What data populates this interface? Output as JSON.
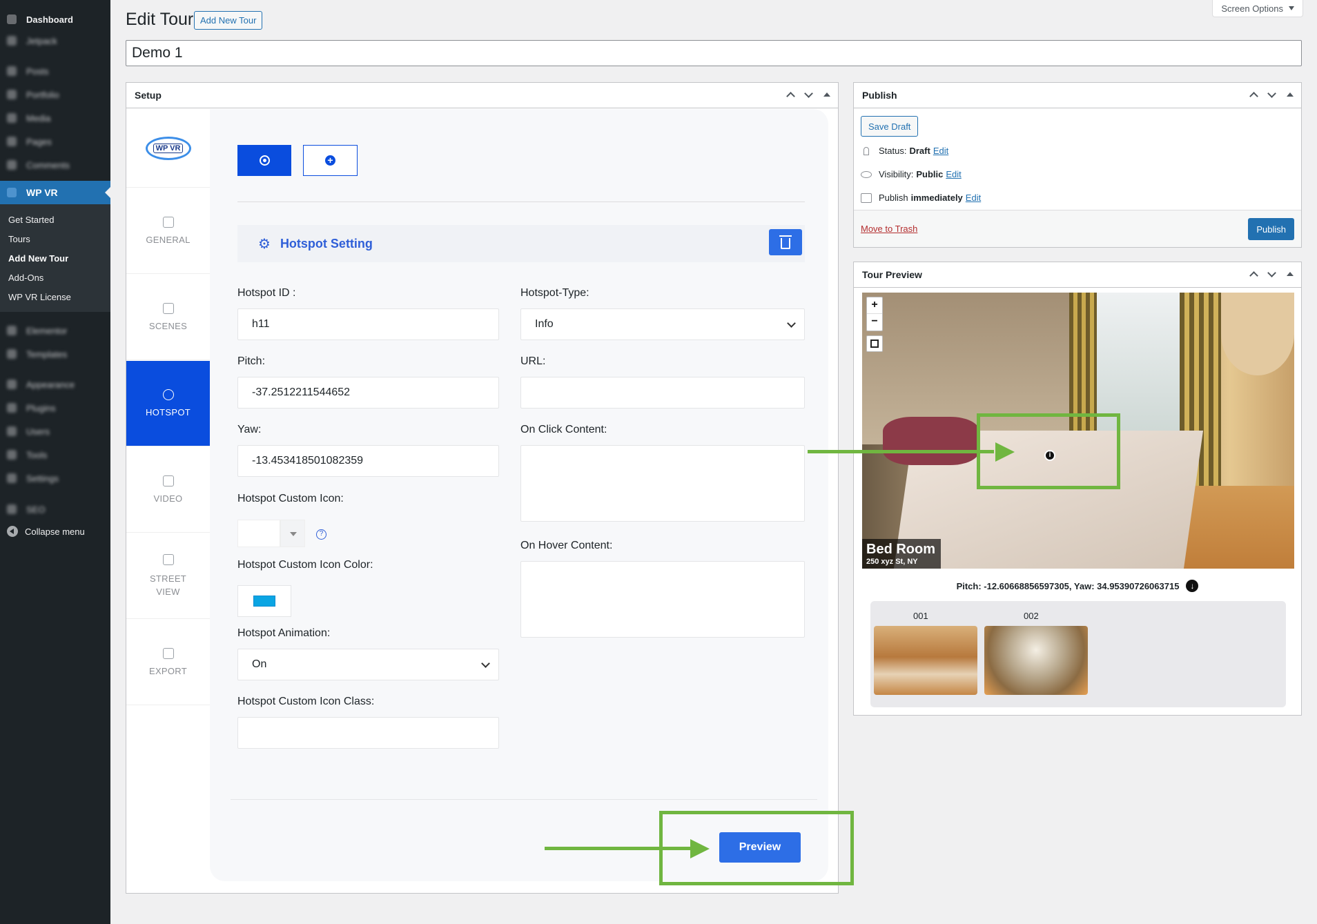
{
  "admin_menu": {
    "top_items": [
      "Dashboard",
      "Jetpack",
      "Posts",
      "Portfolio",
      "Media",
      "Pages",
      "Comments"
    ],
    "active_item": "WP VR",
    "submenu": [
      "Get Started",
      "Tours",
      "Add New Tour",
      "Add-Ons",
      "WP VR License"
    ],
    "bottom_items": [
      "Elementor",
      "Templates",
      "Appearance",
      "Plugins",
      "Users",
      "Tools",
      "Settings",
      "SEO"
    ],
    "collapse_label": "Collapse menu"
  },
  "header": {
    "title": "Edit Tour",
    "add_new_label": "Add New Tour",
    "screen_options_label": "Screen Options",
    "post_title": "Demo 1"
  },
  "setup": {
    "box_title": "Setup",
    "logo_text": "WP VR",
    "tabs": [
      "GENERAL",
      "SCENES",
      "HOTSPOT",
      "VIDEO",
      "STREET VIEW",
      "EXPORT"
    ],
    "active_tab": "HOTSPOT",
    "hotspot_section_title": "Hotspot Setting",
    "fields": {
      "hotspot_id_label": "Hotspot ID :",
      "hotspot_id_value": "h11",
      "hotspot_type_label": "Hotspot-Type:",
      "hotspot_type_value": "Info",
      "pitch_label": "Pitch:",
      "pitch_value": "-37.2512211544652",
      "url_label": "URL:",
      "url_value": "",
      "yaw_label": "Yaw:",
      "yaw_value": "-13.453418501082359",
      "on_click_label": "On Click Content:",
      "custom_icon_label": "Hotspot Custom Icon:",
      "on_hover_label": "On Hover Content:",
      "icon_color_label": "Hotspot Custom Icon Color:",
      "icon_color_value": "#0ba5e3",
      "animation_label": "Hotspot Animation:",
      "animation_value": "On",
      "icon_class_label": "Hotspot Custom Icon Class:",
      "icon_class_value": ""
    },
    "preview_label": "Preview"
  },
  "publish": {
    "box_title": "Publish",
    "save_draft_label": "Save Draft",
    "status_label": "Status:",
    "status_value": "Draft",
    "visibility_label": "Visibility:",
    "visibility_value": "Public",
    "publish_label": "Publish",
    "publish_value": "immediately",
    "edit_label": "Edit",
    "trash_label": "Move to Trash",
    "publish_button_label": "Publish"
  },
  "tour_preview": {
    "box_title": "Tour Preview",
    "zoom_in": "+",
    "zoom_out": "−",
    "scene_name": "Bed Room",
    "scene_address": "250 xyz St, NY",
    "coords_text": "Pitch: -12.60668856597305, Yaw: 34.95390726063715",
    "thumbnails": [
      "001",
      "002"
    ]
  },
  "colors": {
    "wp_blue": "#2271b1",
    "accent_blue": "#0a4dde",
    "annotation_green": "#70b640"
  }
}
